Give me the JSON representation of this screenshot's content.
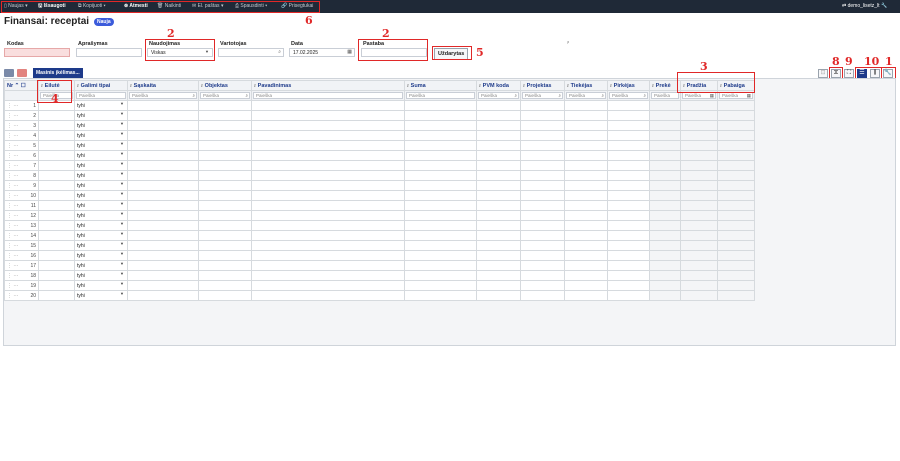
{
  "toolbar": {
    "items": [
      {
        "label": "Naujas",
        "icon": "new-doc-icon"
      },
      {
        "label": "Išsaugoti",
        "icon": "save-icon"
      },
      {
        "label": "Kopijuoti",
        "icon": "copy-icon"
      },
      {
        "label": "Atmesti",
        "icon": "discard-icon"
      },
      {
        "label": "Naikinti",
        "icon": "trash-icon"
      },
      {
        "label": "El. paštas",
        "icon": "mail-icon"
      },
      {
        "label": "Spausdinti",
        "icon": "print-icon"
      },
      {
        "label": "Prisegtukai",
        "icon": "attachment-icon"
      }
    ],
    "user": "demo_lisetz_lt"
  },
  "page": {
    "title": "Finansai: receptai",
    "badge": "Nauja"
  },
  "fields": {
    "kodas_label": "Kodas",
    "aprasymas_label": "Aprašymas",
    "naudojimas_label": "Naudojimas",
    "naudojimas_value": "Viskas",
    "vartotojas_label": "Vartotojas",
    "data_label": "Data",
    "data_value": "17.02.2025",
    "pastaba_label": "Pastaba",
    "uzdarytas_label": "Uždarytas"
  },
  "grid": {
    "masinis_button": "Masinis įkėlimas...",
    "columns": [
      "Nr",
      "Eilutė",
      "Galimi tipai",
      "Sąskaita",
      "Objektas",
      "Pavadinimas",
      "Suma",
      "PVM koda",
      "Projektas",
      "Tiekėjas",
      "Pirkėjas",
      "Prekė",
      "Pradžia",
      "Pabaiga"
    ],
    "search_placeholder": "Paieška",
    "row_type_value": "tyhi",
    "rows": [
      1,
      2,
      3,
      4,
      5,
      6,
      7,
      8,
      9,
      10,
      11,
      12,
      13,
      14,
      15,
      16,
      17,
      18,
      19,
      20
    ]
  },
  "annotations": [
    "1",
    "2",
    "2",
    "3",
    "4",
    "5",
    "6",
    "8",
    "9",
    "10"
  ]
}
